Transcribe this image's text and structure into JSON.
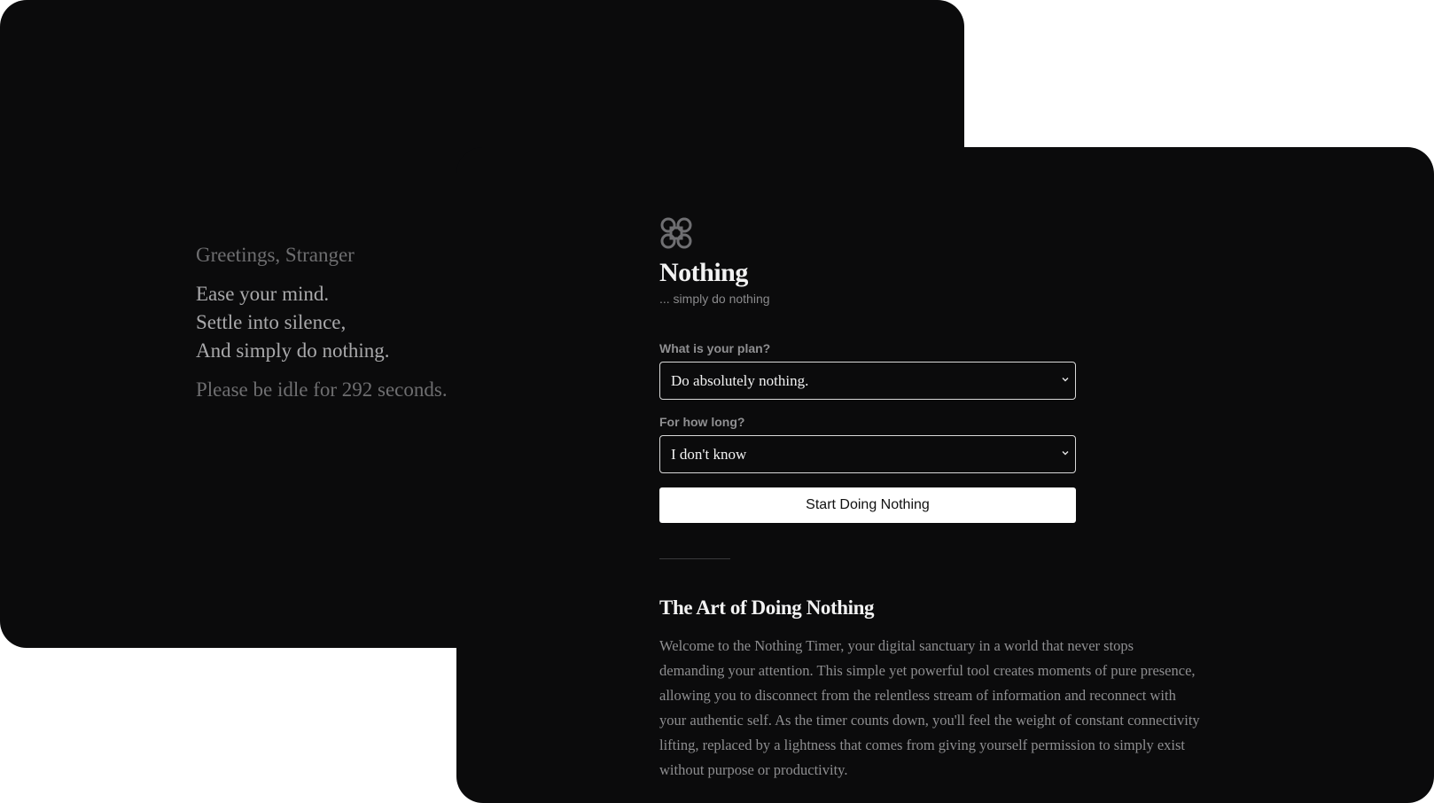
{
  "idle_screen": {
    "greeting": "Greetings, Stranger",
    "poem": [
      "Ease your mind.",
      "Settle into silence,",
      "And simply do nothing."
    ],
    "idle_note": "Please be idle for 292 seconds."
  },
  "app": {
    "logo_icon": "quatrefoil-knot-icon",
    "title": "Nothing",
    "tagline": "... simply do nothing"
  },
  "form": {
    "plan_label": "What is your plan?",
    "plan_selected": "Do absolutely nothing.",
    "duration_label": "For how long?",
    "duration_selected": "I don't know",
    "start_button": "Start Doing Nothing"
  },
  "article": {
    "title": "The Art of Doing Nothing",
    "body": "Welcome to the Nothing Timer, your digital sanctuary in a world that never stops demanding your attention. This simple yet powerful tool creates moments of pure presence, allowing you to disconnect from the relentless stream of information and reconnect with your authentic self. As the timer counts down, you'll feel the weight of constant connectivity lifting, replaced by a lightness that comes from giving yourself permission to simply exist without purpose or productivity."
  },
  "colors": {
    "window_background": "#0b0b0c",
    "page_background": "#ffffff",
    "button_background": "#ffffff"
  }
}
